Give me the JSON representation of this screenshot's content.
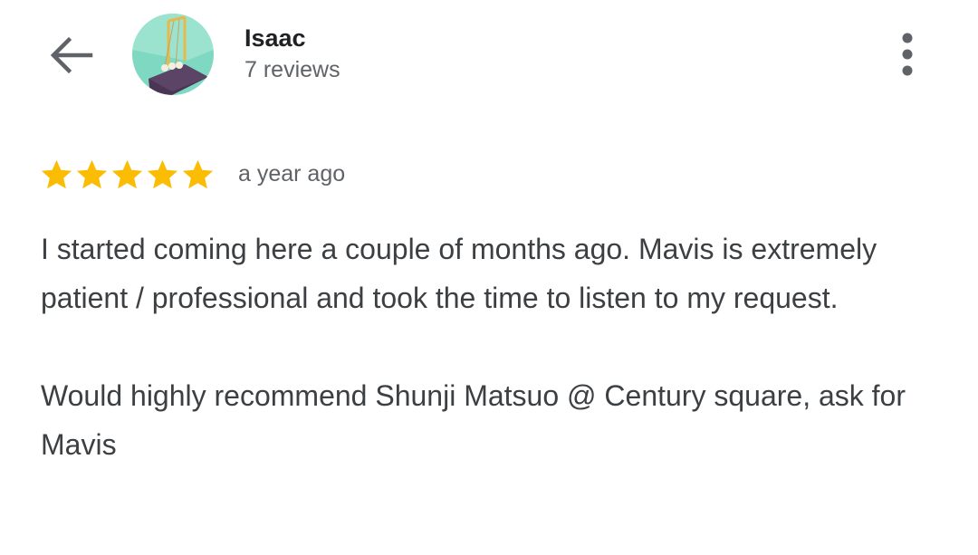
{
  "header": {
    "back_icon": "arrow-back-icon",
    "avatar_icon": "newtons-cradle-avatar",
    "name": "Isaac",
    "reviews_count": "7 reviews",
    "more_icon": "more-vertical-icon"
  },
  "review": {
    "rating": 5,
    "max_rating": 5,
    "time": "a year ago",
    "paragraphs": [
      "I started coming here a couple of months ago. Mavis is extremely patient / professional and took the time to listen to my request.",
      "Would highly recommend Shunji Matsuo @ Century square, ask for Mavis"
    ]
  },
  "colors": {
    "star": "#fbbc04",
    "text_primary": "#202124",
    "text_body": "#3c4043",
    "text_secondary": "#5f6368",
    "avatar_bg": "#7fd8c1"
  }
}
